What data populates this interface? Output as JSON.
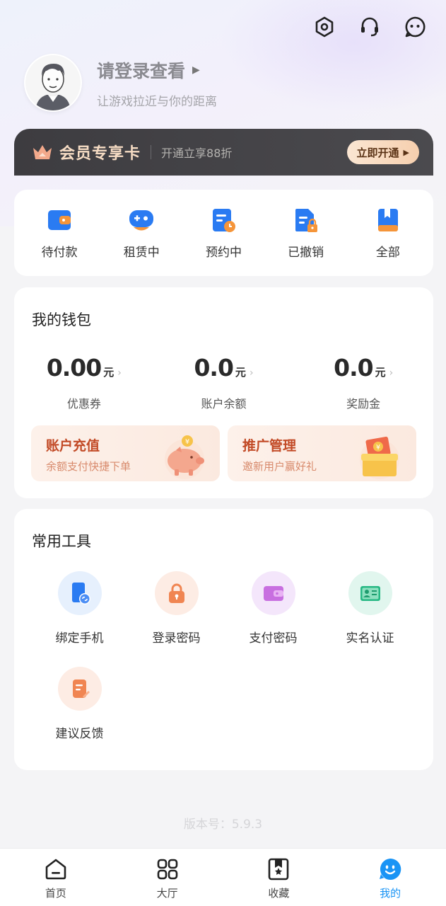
{
  "header": {
    "icons": [
      "settings-icon",
      "customer-service-icon",
      "message-icon"
    ],
    "login_title": "请登录查看",
    "login_subtitle": "让游戏拉近与你的距离"
  },
  "vip": {
    "title": "会员专享卡",
    "description": "开通立享88折",
    "button_label": "立即开通"
  },
  "orders": [
    {
      "label": "待付款",
      "icon": "wallet-icon"
    },
    {
      "label": "租赁中",
      "icon": "gamepad-icon"
    },
    {
      "label": "预约中",
      "icon": "schedule-icon"
    },
    {
      "label": "已撤销",
      "icon": "locked-document-icon"
    },
    {
      "label": "全部",
      "icon": "bookmark-book-icon"
    }
  ],
  "wallet": {
    "title": "我的钱包",
    "stats": [
      {
        "value": "0.00",
        "unit": "元",
        "label": "优惠券"
      },
      {
        "value": "0.0",
        "unit": "元",
        "label": "账户余额"
      },
      {
        "value": "0.0",
        "unit": "元",
        "label": "奖励金"
      }
    ],
    "promos": [
      {
        "title": "账户充值",
        "subtitle": "余额支付快捷下单",
        "icon": "piggy-bank-icon"
      },
      {
        "title": "推广管理",
        "subtitle": "邀新用户赢好礼",
        "icon": "gift-box-icon"
      }
    ]
  },
  "tools": {
    "title": "常用工具",
    "items": [
      {
        "label": "绑定手机",
        "icon": "phone-link-icon"
      },
      {
        "label": "登录密码",
        "icon": "lock-icon"
      },
      {
        "label": "支付密码",
        "icon": "wallet-icon"
      },
      {
        "label": "实名认证",
        "icon": "id-card-icon"
      },
      {
        "label": "建议反馈",
        "icon": "feedback-icon"
      }
    ]
  },
  "version_text": "版本号：5.9.3",
  "tabbar": [
    {
      "label": "首页",
      "icon": "home-icon"
    },
    {
      "label": "大厅",
      "icon": "grid-icon"
    },
    {
      "label": "收藏",
      "icon": "bookmark-star-icon"
    },
    {
      "label": "我的",
      "icon": "smile-face-icon",
      "active": true
    }
  ],
  "colors": {
    "accent": "#1a94f5",
    "order_icon_blue": "#2a7bf2",
    "order_icon_orange": "#f5953a",
    "promo_red": "#c24a26",
    "vip_gold": "#f6dcc4"
  }
}
